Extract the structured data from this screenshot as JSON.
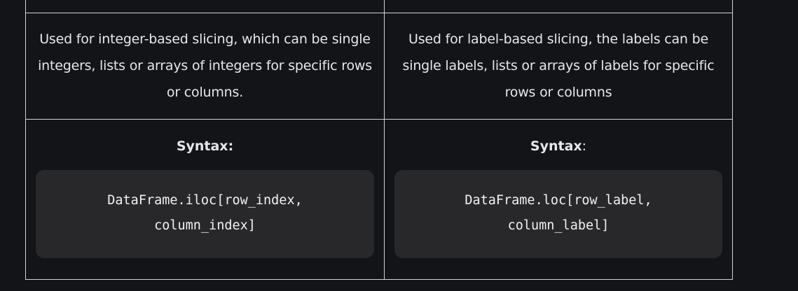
{
  "table": {
    "iloc": {
      "description": "Used for integer-based slicing, which can be single integers, lists or arrays of integers for specific rows or columns.",
      "syntax_label": "Syntax:",
      "code_line1": "DataFrame.iloc[row_index,",
      "code_line2": "column_index]"
    },
    "loc": {
      "description": "Used for label-based slicing, the labels can be single labels, lists or arrays of labels for specific rows or columns",
      "syntax_label": "Syntax",
      "syntax_colon": ":",
      "code_line1": "DataFrame.loc[row_label,",
      "code_line2": "column_label]"
    }
  }
}
